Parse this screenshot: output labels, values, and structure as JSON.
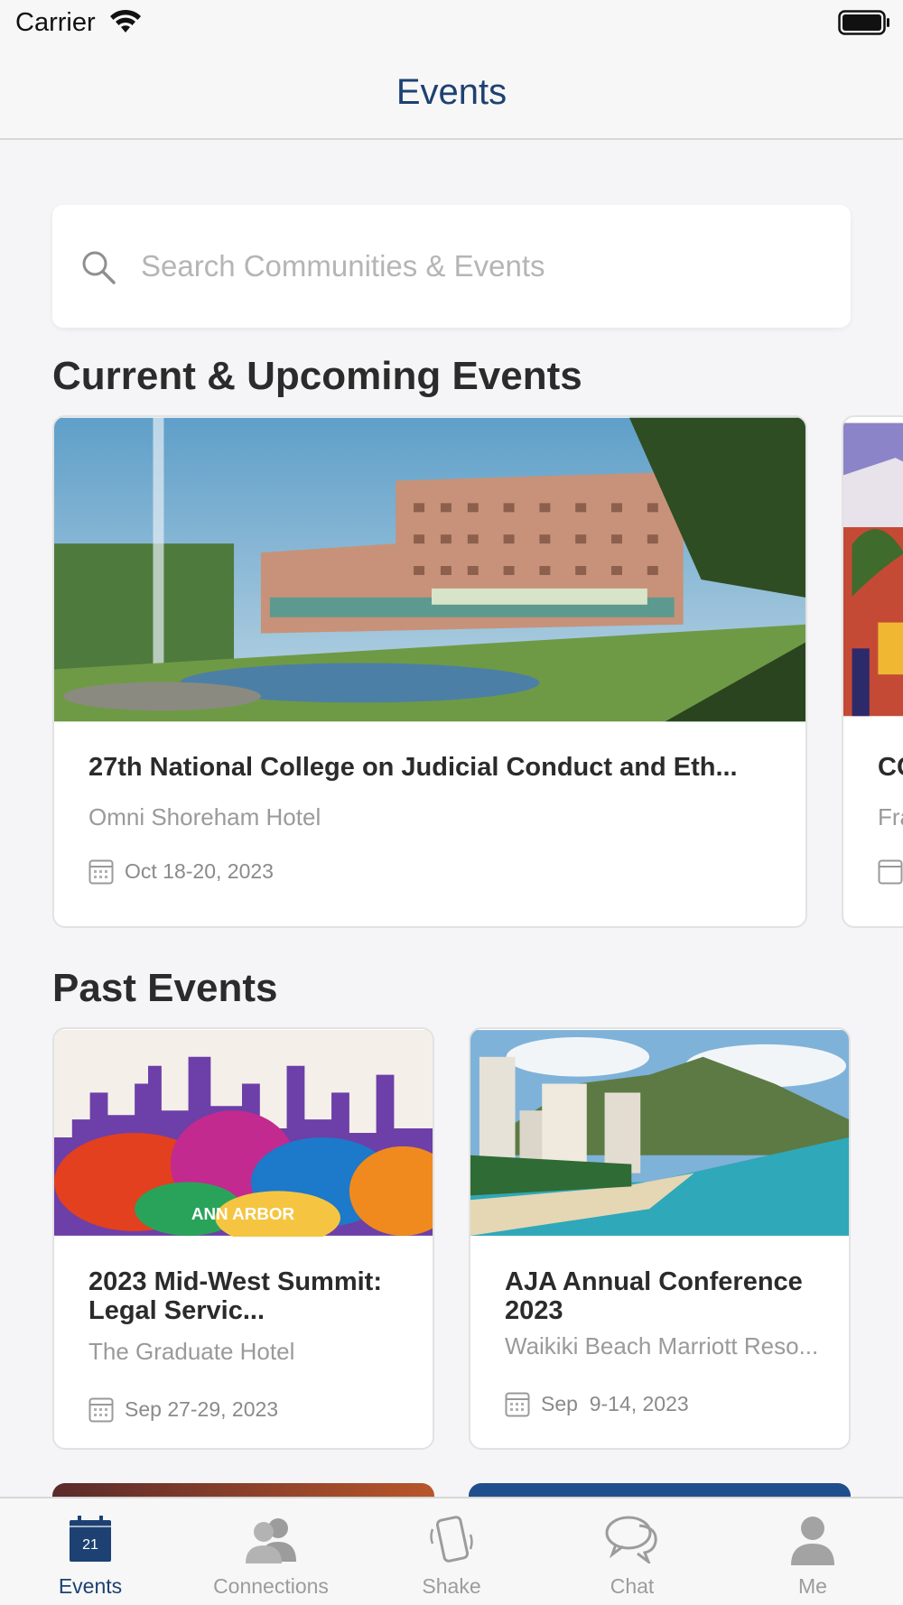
{
  "status_bar": {
    "carrier": "Carrier"
  },
  "nav": {
    "title": "Events"
  },
  "search": {
    "placeholder": "Search Communities & Events"
  },
  "sections": {
    "current_title": "Current & Upcoming Events",
    "past_title": "Past Events"
  },
  "current_events": [
    {
      "title": "27th National College on Judicial Conduct and Eth...",
      "venue": "Omni Shoreham Hotel",
      "date": "Oct 18-20, 2023"
    },
    {
      "title": "CC",
      "venue": "Fra"
    }
  ],
  "past_events": [
    {
      "title": "2023 Mid-West Summit: Legal Servic...",
      "venue": "The Graduate Hotel",
      "date": "Sep 27-29, 2023",
      "image_text": "ANN ARBOR"
    },
    {
      "title": "AJA Annual Conference 2023",
      "venue": "Waikiki Beach Marriott Reso...",
      "date": "Sep  9-14, 2023"
    }
  ],
  "tab_bar": {
    "tabs": [
      {
        "label": "Events",
        "icon": "calendar-icon",
        "icon_text": "21",
        "active": true
      },
      {
        "label": "Connections",
        "icon": "people-icon"
      },
      {
        "label": "Shake",
        "icon": "phone-shake-icon"
      },
      {
        "label": "Chat",
        "icon": "chat-bubbles-icon"
      },
      {
        "label": "Me",
        "icon": "person-icon"
      }
    ]
  },
  "colors": {
    "accent": "#1d4172",
    "background": "#f5f5f7",
    "muted": "#9c9c9c"
  }
}
